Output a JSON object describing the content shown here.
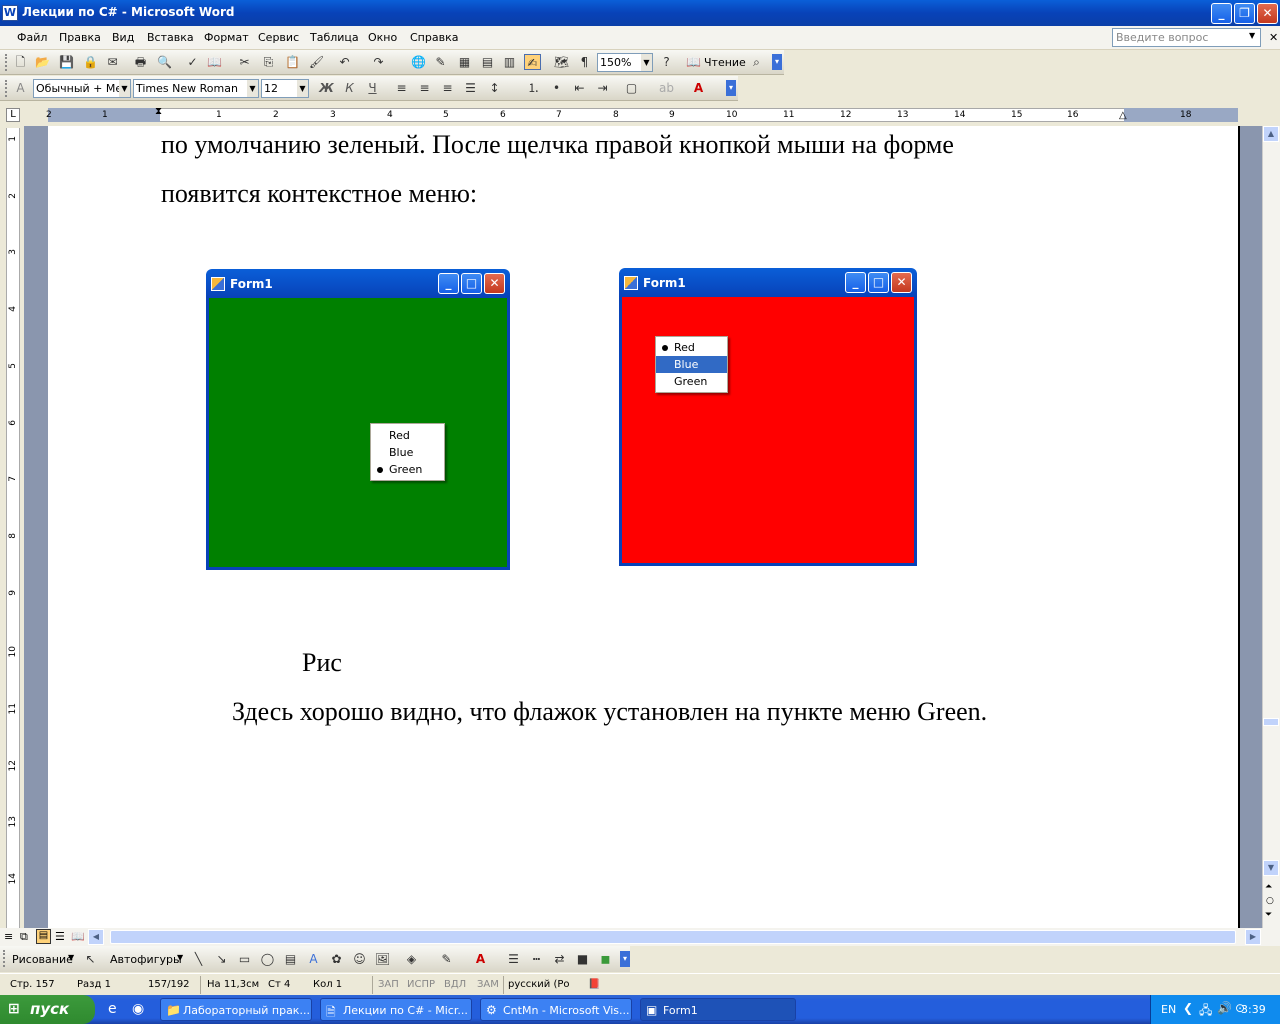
{
  "window": {
    "title": "Лекции по C# - Microsoft Word"
  },
  "menu": {
    "items": [
      "Файл",
      "Правка",
      "Вид",
      "Вставка",
      "Формат",
      "Сервис",
      "Таблица",
      "Окно",
      "Справка"
    ],
    "help_placeholder": "Введите вопрос"
  },
  "toolbar": {
    "zoom": "150%",
    "reading_label": "Чтение"
  },
  "format": {
    "style": "Обычный + Меж",
    "font": "Times New Roman",
    "size": "12"
  },
  "ruler": {
    "h_numbers": [
      "2",
      "1",
      "1",
      "2",
      "3",
      "4",
      "5",
      "6",
      "7",
      "8",
      "9",
      "10",
      "11",
      "12",
      "13",
      "14",
      "15",
      "16",
      "18"
    ],
    "v_numbers": [
      "1",
      "2",
      "3",
      "4",
      "5",
      "6",
      "7",
      "8",
      "9",
      "10",
      "11",
      "12",
      "13",
      "14"
    ]
  },
  "document": {
    "line1": "по  умолчанию  зеленый.  После  щелчка  правой  кнопкой  мыши  на  форме",
    "line2": "появится контекстное меню:",
    "caption": "Рис",
    "line3": "Здесь хорошо видно, что флажок установлен на пункте меню Green."
  },
  "form_left": {
    "title": "Form1",
    "bg": "#008000",
    "menu": [
      "Red",
      "Blue",
      "Green"
    ],
    "checked": "Green"
  },
  "form_right": {
    "title": "Form1",
    "bg": "#FF0000",
    "menu": [
      "Red",
      "Blue",
      "Green"
    ],
    "checked": "Red",
    "highlighted": "Blue"
  },
  "drawbar": {
    "draw": "Рисование",
    "autoshapes": "Автофигуры"
  },
  "status": {
    "page": "Стр. 157",
    "section": "Разд 1",
    "pages": "157/192",
    "at": "На 11,3см",
    "line": "Ст 4",
    "col": "Кол 1",
    "rec": "ЗАП",
    "trk": "ИСПР",
    "ext": "ВДЛ",
    "ovr": "ЗАМ",
    "lang": "русский (Ро"
  },
  "taskbar": {
    "start": "пуск",
    "tasks": [
      "Лабораторный прак...",
      "Лекции по C# - Micr...",
      "CntMn - Microsoft Vis...",
      "Form1"
    ],
    "lang": "EN",
    "clock": "3:39"
  }
}
